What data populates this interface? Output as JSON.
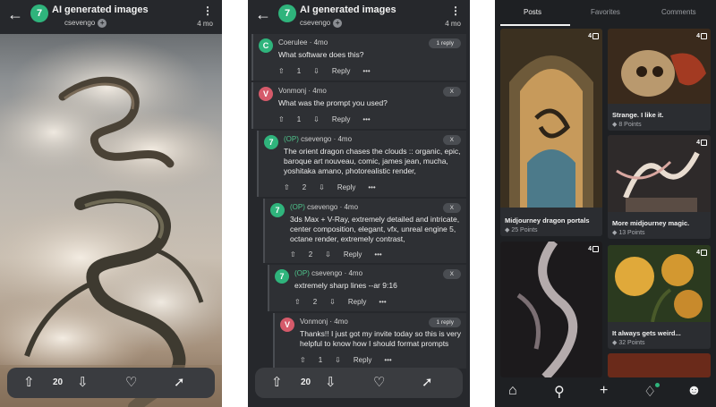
{
  "post": {
    "subreddit": "AI generated images",
    "avatar_letter": "7",
    "username": "csevengo",
    "age": "4 mo",
    "vote_count": "20"
  },
  "comments": [
    {
      "author": "Coerulee",
      "age": "4mo",
      "avatar_letter": "C",
      "text": "What software does this?",
      "votes": "1",
      "pill": "1 reply",
      "op": ""
    },
    {
      "author": "Vonmonj",
      "age": "4mo",
      "avatar_letter": "V",
      "text": "What was the prompt you used?",
      "votes": "1",
      "pill": "X",
      "op": ""
    },
    {
      "author": "csevengo",
      "age": "4mo",
      "avatar_letter": "7",
      "text": "The orient dragon chases the clouds :: organic, epic, baroque art nouveau, comic, james jean, mucha, yoshitaka amano, photorealistic render,",
      "votes": "2",
      "pill": "X",
      "op": "(OP)"
    },
    {
      "author": "csevengo",
      "age": "4mo",
      "avatar_letter": "7",
      "text": "3ds Max + V-Ray, extremely detailed and intricate, center composition, elegant, vfx, unreal engine 5, octane render, extremely contrast,",
      "votes": "2",
      "pill": "X",
      "op": "(OP)"
    },
    {
      "author": "csevengo",
      "age": "4mo",
      "avatar_letter": "7",
      "text": "extremely sharp lines --ar 9:16",
      "votes": "2",
      "pill": "X",
      "op": "(OP)"
    },
    {
      "author": "Vonmonj",
      "age": "4mo",
      "avatar_letter": "V",
      "text": "Thanks!! I just got my invite today so this is very helpful to know how I should format prompts",
      "votes": "1",
      "pill": "1 reply",
      "op": ""
    }
  ],
  "reply_label": "Reply",
  "more_label": "•••",
  "tabs": [
    "Posts",
    "Favorites",
    "Comments"
  ],
  "tiles": [
    {
      "title": "Midjourney dragon portals",
      "points": "25 Points",
      "count": "4"
    },
    {
      "title": "Strange. I like it.",
      "points": "8 Points",
      "count": "4"
    },
    {
      "title": "More midjourney magic.",
      "points": "13 Points",
      "count": "4"
    },
    {
      "title": "It always gets weird...",
      "points": "32 Points",
      "count": "4"
    },
    {
      "title": "",
      "points": "",
      "count": "4"
    }
  ],
  "colors": {
    "accent": "#2fb47c",
    "background": "#26282c",
    "op": "#4fc48c"
  },
  "icons": [
    "back-arrow-icon",
    "kebab-menu-icon",
    "upvote-icon",
    "downvote-icon",
    "heart-icon",
    "share-icon",
    "home-icon",
    "search-icon",
    "plus-icon",
    "bell-icon",
    "profile-icon"
  ]
}
